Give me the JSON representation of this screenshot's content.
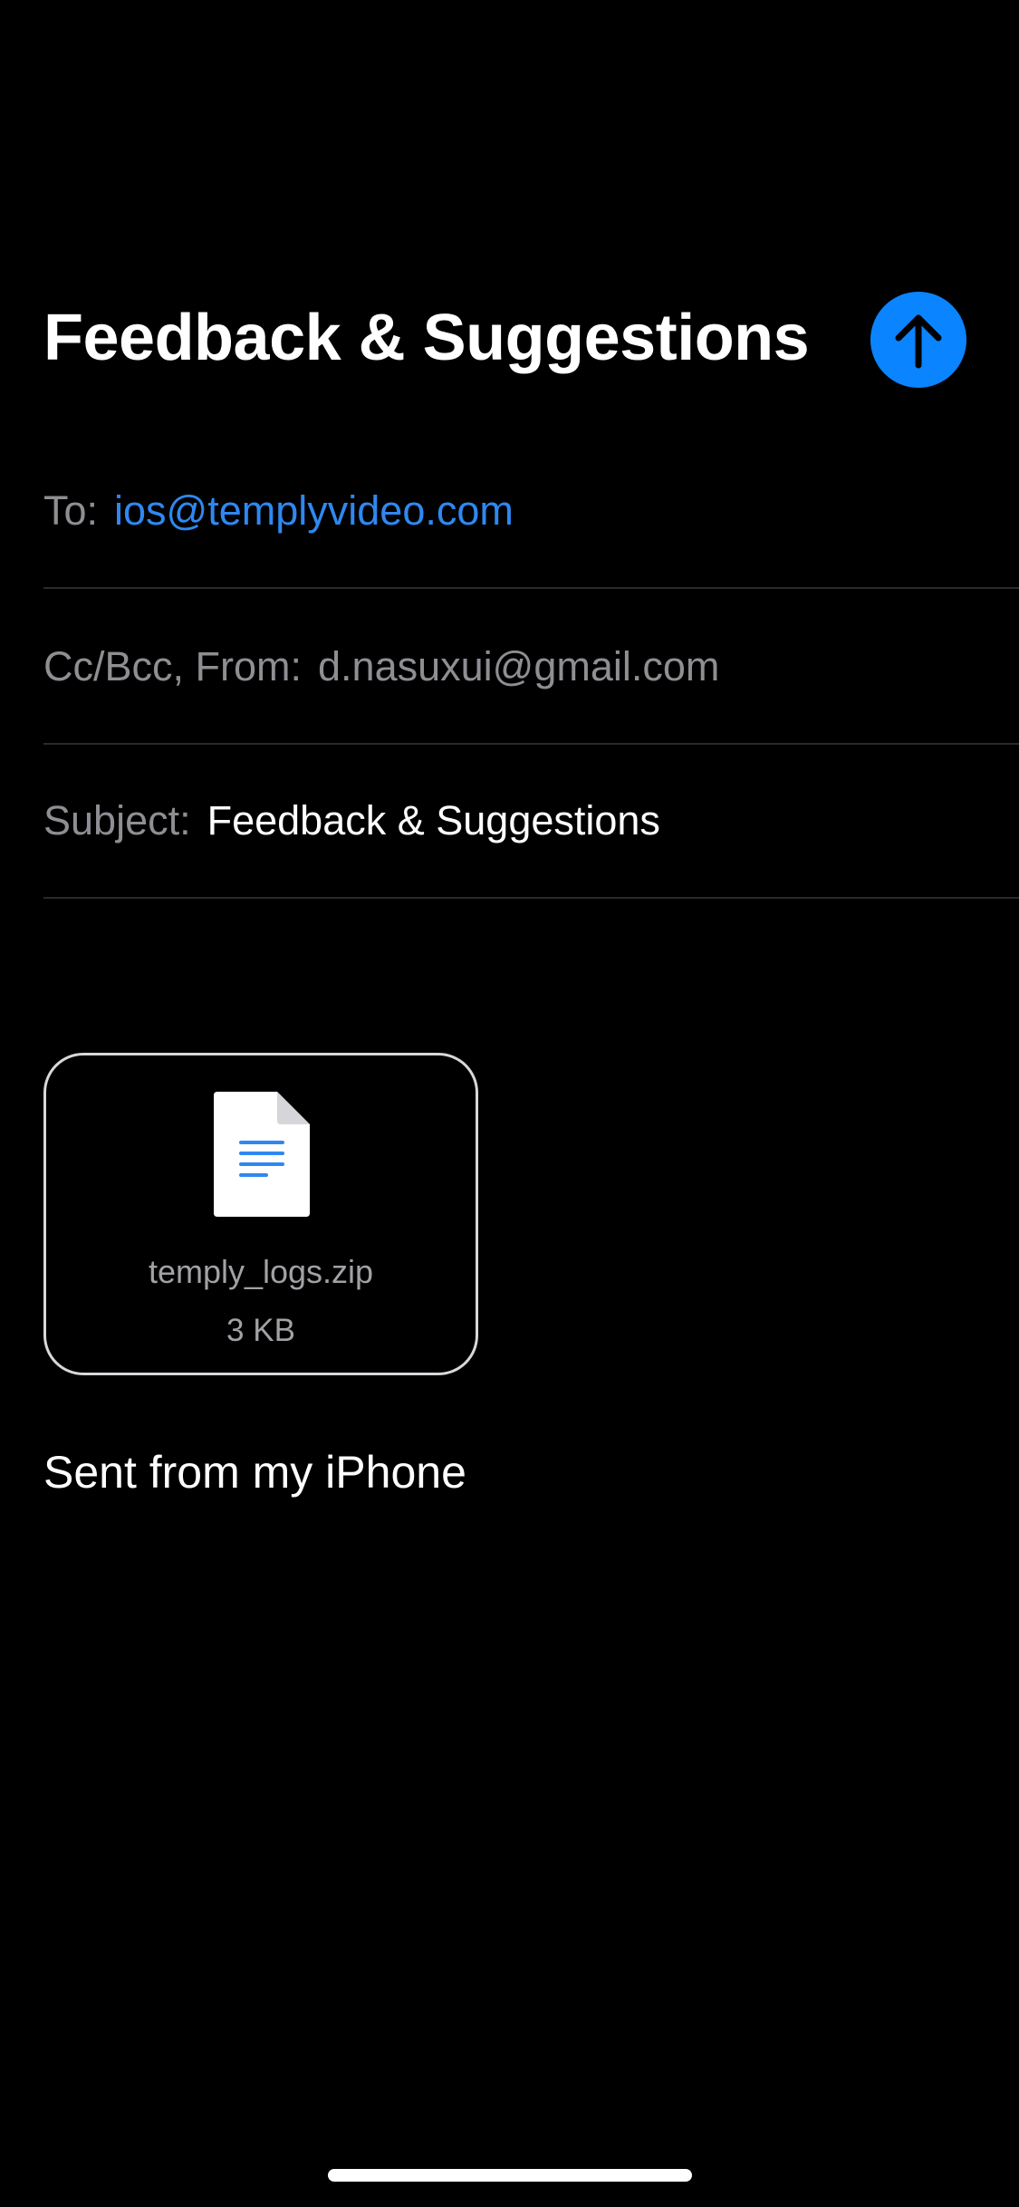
{
  "compose": {
    "title": "Feedback & Suggestions",
    "send_icon": "arrow-up-icon",
    "to_label": "To:",
    "to_value": "ios@templyvideo.com",
    "ccbcc_label": "Cc/Bcc, From:",
    "from_value": "d.nasuxui@gmail.com",
    "subject_label": "Subject:",
    "subject_value": "Feedback & Suggestions",
    "signature": "Sent from my iPhone"
  },
  "attachment": {
    "icon": "document-icon",
    "name": "temply_logs.zip",
    "size": "3 KB"
  },
  "colors": {
    "background": "#000000",
    "accent": "#0a84ff",
    "link": "#2f88f0",
    "secondary_text": "#8e8e93",
    "separator": "#2a2a2c"
  }
}
